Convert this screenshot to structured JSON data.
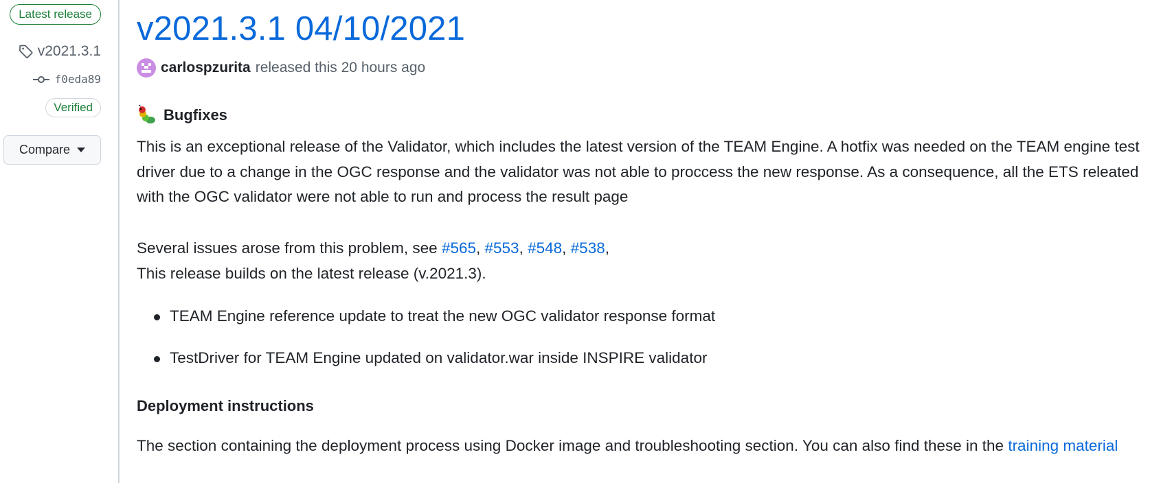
{
  "sidebar": {
    "latest_badge": "Latest release",
    "tag": "v2021.3.1",
    "commit_sha": "f0eda89",
    "verified_badge": "Verified",
    "compare_label": "Compare"
  },
  "release": {
    "title": "v2021.3.1 04/10/2021",
    "author": "carlospzurita",
    "released_text": "released this 20 hours ago"
  },
  "body": {
    "bugfixes_heading": "Bugfixes",
    "para1": "This is an exceptional release of the Validator, which includes the latest version of the TEAM Engine. A hotfix was needed on the TEAM engine test driver due to a change in the OGC response and the validator was not able to proccess the new response. As a consequence, all the ETS releated with the OGC validator were not able to run and process the result page",
    "issues_prefix": "Several issues arose from this problem, see ",
    "issues": [
      "#565",
      "#553",
      "#548",
      "#538"
    ],
    "issues_suffix": ",",
    "builds_on": "This release builds on the latest release (v.2021.3).",
    "bullets": [
      "TEAM Engine reference update to treat the new OGC validator response format",
      "TestDriver for TEAM Engine updated on validator.war inside INSPIRE validator"
    ],
    "deploy_heading": "Deployment instructions",
    "deploy_text": "The section containing the deployment process using Docker image and troubleshooting section. You can also find these in the ",
    "deploy_link": "training material"
  },
  "colors": {
    "link": "#0969da",
    "success": "#1a7f37",
    "text": "#1f2328",
    "muted": "#57606a",
    "avatar": "#c98de3"
  },
  "icons": [
    "tag-icon",
    "git-commit-icon",
    "caret-down-icon",
    "bug-emoji-icon",
    "user-avatar"
  ]
}
